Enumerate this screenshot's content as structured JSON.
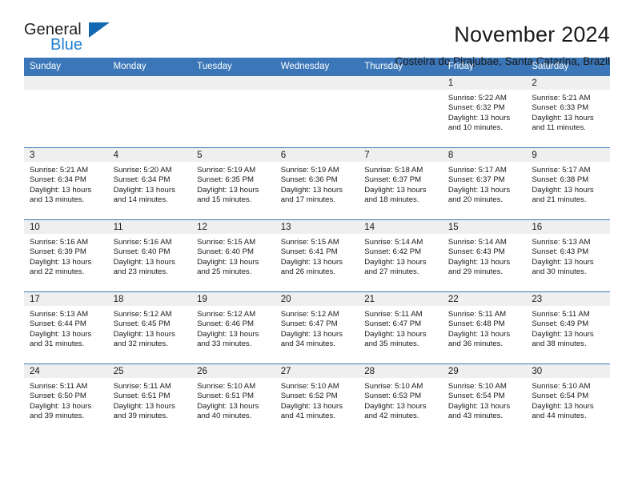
{
  "logo": {
    "line1": "General",
    "line2": "Blue",
    "accent_color": "#1268b3"
  },
  "header": {
    "title": "November 2024",
    "subtitle": "Costeira do Pirajubae, Santa Catarina, Brazil",
    "header_bg": "#3a76b8",
    "daynum_bg": "#efefef"
  },
  "weekday_headers": [
    "Sunday",
    "Monday",
    "Tuesday",
    "Wednesday",
    "Thursday",
    "Friday",
    "Saturday"
  ],
  "weeks": [
    [
      {
        "day": "",
        "sunrise": "",
        "sunset": "",
        "daylight1": "",
        "daylight2": ""
      },
      {
        "day": "",
        "sunrise": "",
        "sunset": "",
        "daylight1": "",
        "daylight2": ""
      },
      {
        "day": "",
        "sunrise": "",
        "sunset": "",
        "daylight1": "",
        "daylight2": ""
      },
      {
        "day": "",
        "sunrise": "",
        "sunset": "",
        "daylight1": "",
        "daylight2": ""
      },
      {
        "day": "",
        "sunrise": "",
        "sunset": "",
        "daylight1": "",
        "daylight2": ""
      },
      {
        "day": "1",
        "sunrise": "Sunrise: 5:22 AM",
        "sunset": "Sunset: 6:32 PM",
        "daylight1": "Daylight: 13 hours",
        "daylight2": "and 10 minutes."
      },
      {
        "day": "2",
        "sunrise": "Sunrise: 5:21 AM",
        "sunset": "Sunset: 6:33 PM",
        "daylight1": "Daylight: 13 hours",
        "daylight2": "and 11 minutes."
      }
    ],
    [
      {
        "day": "3",
        "sunrise": "Sunrise: 5:21 AM",
        "sunset": "Sunset: 6:34 PM",
        "daylight1": "Daylight: 13 hours",
        "daylight2": "and 13 minutes."
      },
      {
        "day": "4",
        "sunrise": "Sunrise: 5:20 AM",
        "sunset": "Sunset: 6:34 PM",
        "daylight1": "Daylight: 13 hours",
        "daylight2": "and 14 minutes."
      },
      {
        "day": "5",
        "sunrise": "Sunrise: 5:19 AM",
        "sunset": "Sunset: 6:35 PM",
        "daylight1": "Daylight: 13 hours",
        "daylight2": "and 15 minutes."
      },
      {
        "day": "6",
        "sunrise": "Sunrise: 5:19 AM",
        "sunset": "Sunset: 6:36 PM",
        "daylight1": "Daylight: 13 hours",
        "daylight2": "and 17 minutes."
      },
      {
        "day": "7",
        "sunrise": "Sunrise: 5:18 AM",
        "sunset": "Sunset: 6:37 PM",
        "daylight1": "Daylight: 13 hours",
        "daylight2": "and 18 minutes."
      },
      {
        "day": "8",
        "sunrise": "Sunrise: 5:17 AM",
        "sunset": "Sunset: 6:37 PM",
        "daylight1": "Daylight: 13 hours",
        "daylight2": "and 20 minutes."
      },
      {
        "day": "9",
        "sunrise": "Sunrise: 5:17 AM",
        "sunset": "Sunset: 6:38 PM",
        "daylight1": "Daylight: 13 hours",
        "daylight2": "and 21 minutes."
      }
    ],
    [
      {
        "day": "10",
        "sunrise": "Sunrise: 5:16 AM",
        "sunset": "Sunset: 6:39 PM",
        "daylight1": "Daylight: 13 hours",
        "daylight2": "and 22 minutes."
      },
      {
        "day": "11",
        "sunrise": "Sunrise: 5:16 AM",
        "sunset": "Sunset: 6:40 PM",
        "daylight1": "Daylight: 13 hours",
        "daylight2": "and 23 minutes."
      },
      {
        "day": "12",
        "sunrise": "Sunrise: 5:15 AM",
        "sunset": "Sunset: 6:40 PM",
        "daylight1": "Daylight: 13 hours",
        "daylight2": "and 25 minutes."
      },
      {
        "day": "13",
        "sunrise": "Sunrise: 5:15 AM",
        "sunset": "Sunset: 6:41 PM",
        "daylight1": "Daylight: 13 hours",
        "daylight2": "and 26 minutes."
      },
      {
        "day": "14",
        "sunrise": "Sunrise: 5:14 AM",
        "sunset": "Sunset: 6:42 PM",
        "daylight1": "Daylight: 13 hours",
        "daylight2": "and 27 minutes."
      },
      {
        "day": "15",
        "sunrise": "Sunrise: 5:14 AM",
        "sunset": "Sunset: 6:43 PM",
        "daylight1": "Daylight: 13 hours",
        "daylight2": "and 29 minutes."
      },
      {
        "day": "16",
        "sunrise": "Sunrise: 5:13 AM",
        "sunset": "Sunset: 6:43 PM",
        "daylight1": "Daylight: 13 hours",
        "daylight2": "and 30 minutes."
      }
    ],
    [
      {
        "day": "17",
        "sunrise": "Sunrise: 5:13 AM",
        "sunset": "Sunset: 6:44 PM",
        "daylight1": "Daylight: 13 hours",
        "daylight2": "and 31 minutes."
      },
      {
        "day": "18",
        "sunrise": "Sunrise: 5:12 AM",
        "sunset": "Sunset: 6:45 PM",
        "daylight1": "Daylight: 13 hours",
        "daylight2": "and 32 minutes."
      },
      {
        "day": "19",
        "sunrise": "Sunrise: 5:12 AM",
        "sunset": "Sunset: 6:46 PM",
        "daylight1": "Daylight: 13 hours",
        "daylight2": "and 33 minutes."
      },
      {
        "day": "20",
        "sunrise": "Sunrise: 5:12 AM",
        "sunset": "Sunset: 6:47 PM",
        "daylight1": "Daylight: 13 hours",
        "daylight2": "and 34 minutes."
      },
      {
        "day": "21",
        "sunrise": "Sunrise: 5:11 AM",
        "sunset": "Sunset: 6:47 PM",
        "daylight1": "Daylight: 13 hours",
        "daylight2": "and 35 minutes."
      },
      {
        "day": "22",
        "sunrise": "Sunrise: 5:11 AM",
        "sunset": "Sunset: 6:48 PM",
        "daylight1": "Daylight: 13 hours",
        "daylight2": "and 36 minutes."
      },
      {
        "day": "23",
        "sunrise": "Sunrise: 5:11 AM",
        "sunset": "Sunset: 6:49 PM",
        "daylight1": "Daylight: 13 hours",
        "daylight2": "and 38 minutes."
      }
    ],
    [
      {
        "day": "24",
        "sunrise": "Sunrise: 5:11 AM",
        "sunset": "Sunset: 6:50 PM",
        "daylight1": "Daylight: 13 hours",
        "daylight2": "and 39 minutes."
      },
      {
        "day": "25",
        "sunrise": "Sunrise: 5:11 AM",
        "sunset": "Sunset: 6:51 PM",
        "daylight1": "Daylight: 13 hours",
        "daylight2": "and 39 minutes."
      },
      {
        "day": "26",
        "sunrise": "Sunrise: 5:10 AM",
        "sunset": "Sunset: 6:51 PM",
        "daylight1": "Daylight: 13 hours",
        "daylight2": "and 40 minutes."
      },
      {
        "day": "27",
        "sunrise": "Sunrise: 5:10 AM",
        "sunset": "Sunset: 6:52 PM",
        "daylight1": "Daylight: 13 hours",
        "daylight2": "and 41 minutes."
      },
      {
        "day": "28",
        "sunrise": "Sunrise: 5:10 AM",
        "sunset": "Sunset: 6:53 PM",
        "daylight1": "Daylight: 13 hours",
        "daylight2": "and 42 minutes."
      },
      {
        "day": "29",
        "sunrise": "Sunrise: 5:10 AM",
        "sunset": "Sunset: 6:54 PM",
        "daylight1": "Daylight: 13 hours",
        "daylight2": "and 43 minutes."
      },
      {
        "day": "30",
        "sunrise": "Sunrise: 5:10 AM",
        "sunset": "Sunset: 6:54 PM",
        "daylight1": "Daylight: 13 hours",
        "daylight2": "and 44 minutes."
      }
    ]
  ]
}
